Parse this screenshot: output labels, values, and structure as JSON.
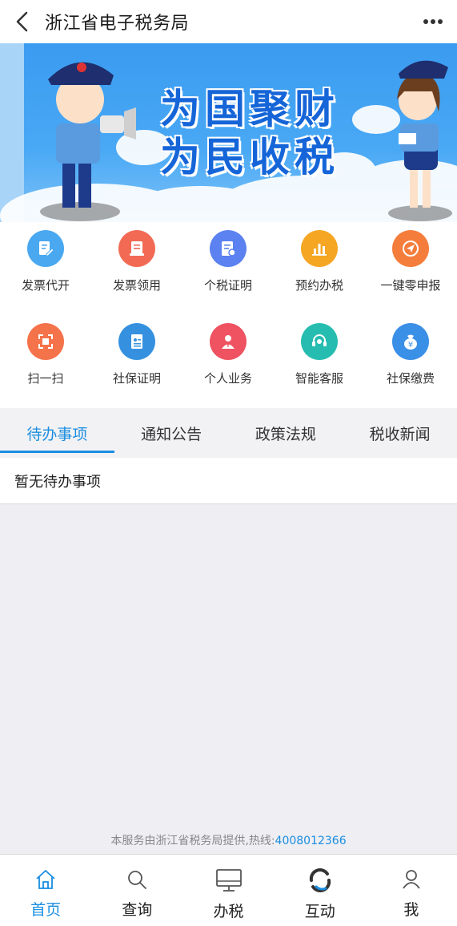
{
  "header": {
    "title": "浙江省电子税务局"
  },
  "banner": {
    "line1": "为国聚财",
    "line2": "为民收税"
  },
  "grid": [
    {
      "label": "发票代开",
      "icon": "invoice-edit-icon",
      "color": "#4aa8f0"
    },
    {
      "label": "发票领用",
      "icon": "invoice-receive-icon",
      "color": "#f26a54"
    },
    {
      "label": "个税证明",
      "icon": "tax-certificate-icon",
      "color": "#5b82f0"
    },
    {
      "label": "预约办税",
      "icon": "bar-chart-icon",
      "color": "#f5a623"
    },
    {
      "label": "一键零申报",
      "icon": "send-arrow-icon",
      "color": "#f57d3c"
    },
    {
      "label": "扫一扫",
      "icon": "scan-icon",
      "color": "#f5734a"
    },
    {
      "label": "社保证明",
      "icon": "id-card-icon",
      "color": "#3591e0"
    },
    {
      "label": "个人业务",
      "icon": "person-icon",
      "color": "#ef5261"
    },
    {
      "label": "智能客服",
      "icon": "headset-icon",
      "color": "#26bdb0"
    },
    {
      "label": "社保缴费",
      "icon": "yuan-bag-icon",
      "color": "#3a8fe6"
    }
  ],
  "tabs": [
    {
      "label": "待办事项",
      "active": true
    },
    {
      "label": "通知公告"
    },
    {
      "label": "政策法规"
    },
    {
      "label": "税收新闻"
    }
  ],
  "todo": {
    "empty_text": "暂无待办事项"
  },
  "footer": {
    "note": "本服务由浙江省税务局提供,热线:",
    "hotline": "4008012366"
  },
  "bottom_nav": [
    {
      "label": "首页",
      "icon": "home-icon",
      "active": true
    },
    {
      "label": "查询",
      "icon": "search-icon"
    },
    {
      "label": "办税",
      "icon": "monitor-icon"
    },
    {
      "label": "互动",
      "icon": "interaction-icon"
    },
    {
      "label": "我",
      "icon": "user-icon"
    }
  ],
  "colors": {
    "accent": "#1a8ee0",
    "banner": "#3a9bf0"
  }
}
